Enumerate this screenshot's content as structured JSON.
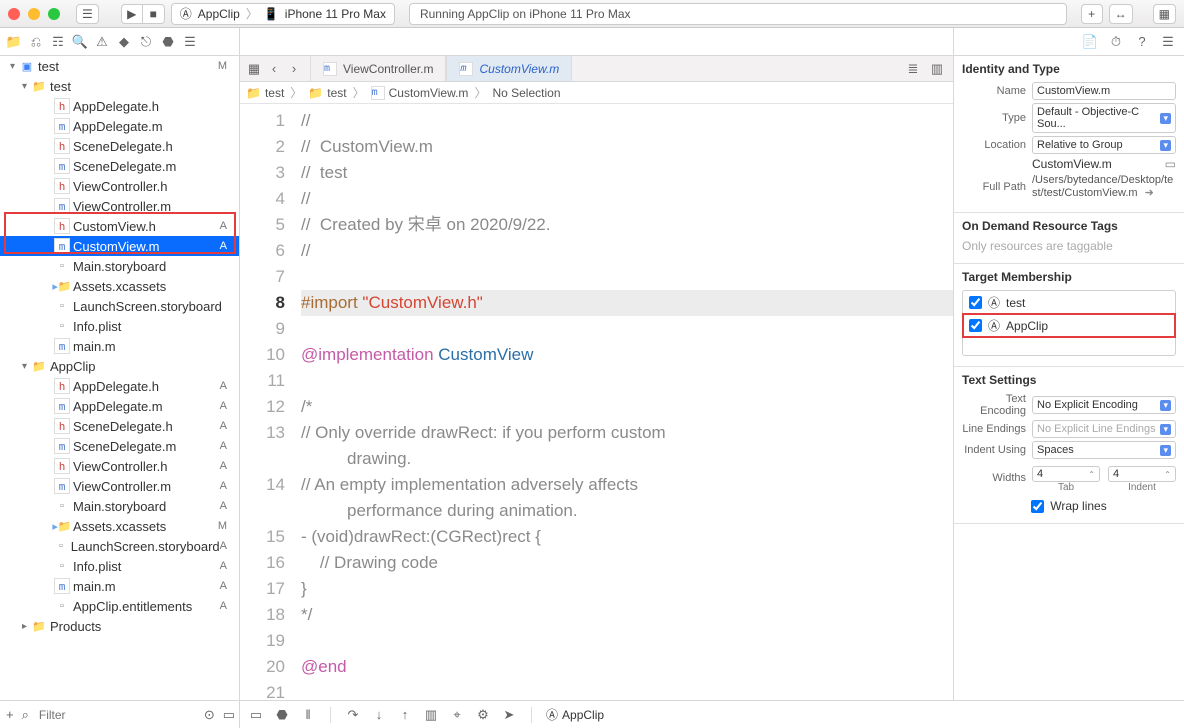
{
  "titlebar": {
    "scheme_app": "AppClip",
    "scheme_device": "iPhone 11 Pro Max",
    "status": "Running AppClip on iPhone 11 Pro Max"
  },
  "navigator": {
    "root": {
      "name": "test",
      "badge": "M"
    },
    "groups": [
      {
        "name": "test",
        "icon": "folder-y",
        "badge": "",
        "items": [
          {
            "name": "AppDelegate.h",
            "icon": "h",
            "badge": ""
          },
          {
            "name": "AppDelegate.m",
            "icon": "m",
            "badge": ""
          },
          {
            "name": "SceneDelegate.h",
            "icon": "h",
            "badge": ""
          },
          {
            "name": "SceneDelegate.m",
            "icon": "m",
            "badge": ""
          },
          {
            "name": "ViewController.h",
            "icon": "h",
            "badge": ""
          },
          {
            "name": "ViewController.m",
            "icon": "m",
            "badge": ""
          },
          {
            "name": "CustomView.h",
            "icon": "h",
            "badge": "A"
          },
          {
            "name": "CustomView.m",
            "icon": "m",
            "badge": "A",
            "selected": true
          },
          {
            "name": "Main.storyboard",
            "icon": "file",
            "badge": ""
          },
          {
            "name": "Assets.xcassets",
            "icon": "folder",
            "badge": ""
          },
          {
            "name": "LaunchScreen.storyboard",
            "icon": "file",
            "badge": ""
          },
          {
            "name": "Info.plist",
            "icon": "file",
            "badge": ""
          },
          {
            "name": "main.m",
            "icon": "m",
            "badge": ""
          }
        ]
      },
      {
        "name": "AppClip",
        "icon": "folder-y",
        "badge": "",
        "items": [
          {
            "name": "AppDelegate.h",
            "icon": "h",
            "badge": "A"
          },
          {
            "name": "AppDelegate.m",
            "icon": "m",
            "badge": "A"
          },
          {
            "name": "SceneDelegate.h",
            "icon": "h",
            "badge": "A"
          },
          {
            "name": "SceneDelegate.m",
            "icon": "m",
            "badge": "A"
          },
          {
            "name": "ViewController.h",
            "icon": "h",
            "badge": "A"
          },
          {
            "name": "ViewController.m",
            "icon": "m",
            "badge": "A"
          },
          {
            "name": "Main.storyboard",
            "icon": "file",
            "badge": "A"
          },
          {
            "name": "Assets.xcassets",
            "icon": "folder",
            "badge": "M"
          },
          {
            "name": "LaunchScreen.storyboard",
            "icon": "file",
            "badge": "A"
          },
          {
            "name": "Info.plist",
            "icon": "file",
            "badge": "A"
          },
          {
            "name": "main.m",
            "icon": "m",
            "badge": "A"
          },
          {
            "name": "AppClip.entitlements",
            "icon": "file",
            "badge": "A"
          }
        ]
      },
      {
        "name": "Products",
        "icon": "folder-y",
        "badge": "",
        "collapsed": true
      }
    ]
  },
  "tabs": [
    {
      "label": "ViewController.m",
      "active": false
    },
    {
      "label": "CustomView.m",
      "active": true
    }
  ],
  "jumpbar": [
    "test",
    "test",
    "CustomView.m",
    "No Selection"
  ],
  "code": {
    "current_line": 8,
    "lines": [
      {
        "n": 1,
        "t": "//",
        "cls": "c-comment"
      },
      {
        "n": 2,
        "t": "//  CustomView.m",
        "cls": "c-comment"
      },
      {
        "n": 3,
        "t": "//  test",
        "cls": "c-comment"
      },
      {
        "n": 4,
        "t": "//",
        "cls": "c-comment"
      },
      {
        "n": 5,
        "t": "//  Created by 宋卓 on 2020/9/22.",
        "cls": "c-comment"
      },
      {
        "n": 6,
        "t": "//",
        "cls": "c-comment"
      },
      {
        "n": 7,
        "t": "",
        "cls": ""
      },
      {
        "n": 8,
        "html": "<span class='c-pp'>#import </span><span class='c-str'>\"CustomView.h\"</span>",
        "hl": true
      },
      {
        "n": 9,
        "t": "",
        "cls": ""
      },
      {
        "n": 10,
        "html": "<span class='c-kw'>@implementation</span> <span class='c-type'>CustomView</span>"
      },
      {
        "n": 11,
        "t": "",
        "cls": ""
      },
      {
        "n": 12,
        "t": "/*",
        "cls": "c-comment"
      },
      {
        "n": 13,
        "t": "// Only override drawRect: if you perform custom",
        "cls": "c-comment",
        "wrap": "drawing."
      },
      {
        "n": 14,
        "t": "// An empty implementation adversely affects",
        "cls": "c-comment",
        "wrap": "performance during animation."
      },
      {
        "n": 15,
        "t": "- (void)drawRect:(CGRect)rect {",
        "cls": "c-comment"
      },
      {
        "n": 16,
        "t": "    // Drawing code",
        "cls": "c-comment"
      },
      {
        "n": 17,
        "t": "}",
        "cls": "c-comment"
      },
      {
        "n": 18,
        "t": "*/",
        "cls": "c-comment"
      },
      {
        "n": 19,
        "t": "",
        "cls": ""
      },
      {
        "n": 20,
        "html": "<span class='c-kw'>@end</span>"
      },
      {
        "n": 21,
        "t": "",
        "cls": ""
      }
    ]
  },
  "inspector": {
    "identity_title": "Identity and Type",
    "name_label": "Name",
    "name_value": "CustomView.m",
    "type_label": "Type",
    "type_value": "Default - Objective-C Sou...",
    "location_label": "Location",
    "location_value": "Relative to Group",
    "location_file": "CustomView.m",
    "fullpath_label": "Full Path",
    "fullpath_value": "/Users/bytedance/Desktop/test/test/CustomView.m",
    "odr_title": "On Demand Resource Tags",
    "odr_placeholder": "Only resources are taggable",
    "tm_title": "Target Membership",
    "targets": [
      {
        "name": "test",
        "checked": true
      },
      {
        "name": "AppClip",
        "checked": true,
        "highlight": true
      }
    ],
    "ts_title": "Text Settings",
    "text_encoding_label": "Text Encoding",
    "text_encoding": "No Explicit Encoding",
    "line_endings_label": "Line Endings",
    "line_endings": "No Explicit Line Endings",
    "indent_label": "Indent Using",
    "indent": "Spaces",
    "widths_label": "Widths",
    "tab": "4",
    "indentw": "4",
    "tab_label": "Tab",
    "indent_col": "Indent",
    "wrap": "Wrap lines"
  },
  "footer": {
    "filter_placeholder": "Filter",
    "debug_target": "AppClip"
  }
}
